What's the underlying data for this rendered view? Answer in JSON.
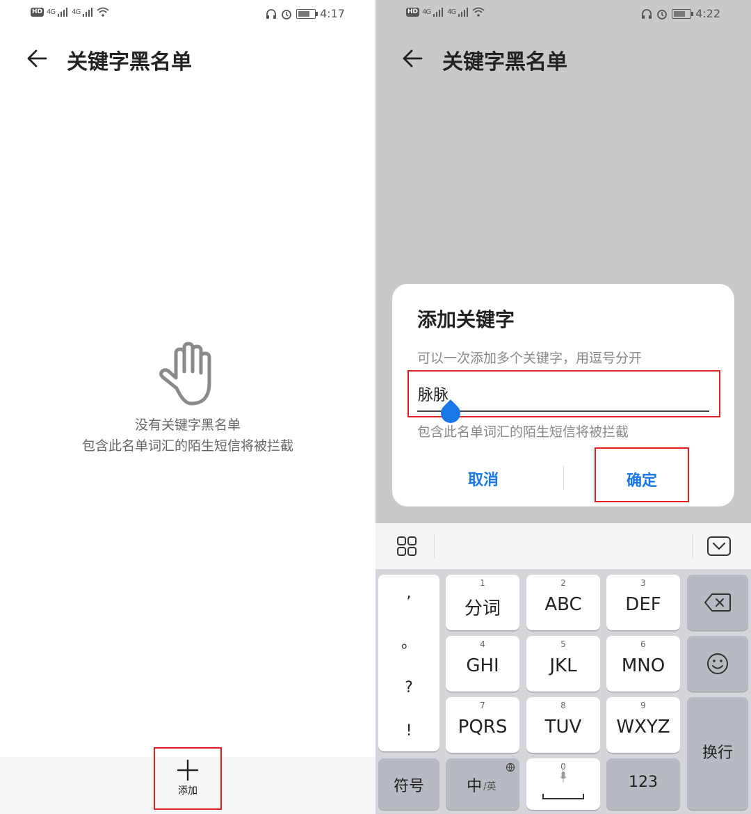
{
  "left": {
    "status": {
      "network": "4G",
      "time": "4:17"
    },
    "title": "关键字黑名单",
    "empty": {
      "line1": "没有关键字黑名单",
      "line2": "包含此名单词汇的陌生短信将被拦截"
    },
    "add_label": "添加"
  },
  "right": {
    "status": {
      "network": "4G",
      "time": "4:22"
    },
    "title": "关键字黑名单",
    "dialog": {
      "title": "添加关键字",
      "hint": "可以一次添加多个关键字，用逗号分开",
      "input_value": "脉脉",
      "description": "包含此名单词汇的陌生短信将被拦截",
      "cancel": "取消",
      "confirm": "确定"
    },
    "keyboard": {
      "punct": [
        ",",
        "。",
        "?",
        "!"
      ],
      "keys": [
        {
          "num": "1",
          "label": "分词"
        },
        {
          "num": "2",
          "label": "ABC"
        },
        {
          "num": "3",
          "label": "DEF"
        },
        {
          "num": "4",
          "label": "GHI"
        },
        {
          "num": "5",
          "label": "JKL"
        },
        {
          "num": "6",
          "label": "MNO"
        },
        {
          "num": "7",
          "label": "PQRS"
        },
        {
          "num": "8",
          "label": "TUV"
        },
        {
          "num": "9",
          "label": "WXYZ"
        }
      ],
      "symbols": "符号",
      "lang_main": "中",
      "lang_sub": "/英",
      "space_num": "0",
      "num_key": "123",
      "enter": "换行"
    }
  },
  "colors": {
    "accent": "#1a78e6",
    "highlight_box": "#e02020",
    "keyboard_bg": "#d4d6db"
  }
}
